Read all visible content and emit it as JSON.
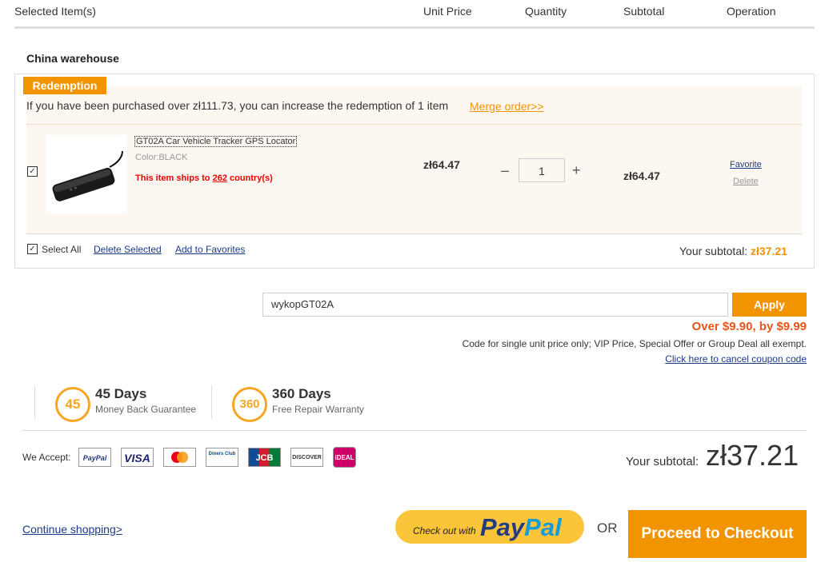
{
  "header": {
    "selected_items": "Selected Item(s)",
    "unit_price": "Unit Price",
    "quantity": "Quantity",
    "subtotal": "Subtotal",
    "operation": "Operation"
  },
  "warehouse": "China warehouse",
  "redemption": {
    "tag": "Redemption",
    "text": "If you have been purchased over zł111.73, you can increase the redemption of 1 item",
    "merge_link": "Merge order>>"
  },
  "item": {
    "checked": true,
    "title": "GT02A Car Vehicle Tracker GPS Locator",
    "color": "Color:BLACK",
    "ships_prefix": "This item ships to ",
    "ships_count": "262",
    "ships_suffix": " country(s)",
    "unit_price": "zł64.47",
    "minus": "–",
    "quantity": "1",
    "plus": "+",
    "subtotal": "zł64.47",
    "favorite": "Favorite",
    "delete": "Delete"
  },
  "footer_bar": {
    "select_all": "Select All",
    "delete_selected": "Delete Selected",
    "add_to_favorites": "Add to Favorites",
    "your_subtotal_label": "Your subtotal: ",
    "your_subtotal_value": "zł37.21"
  },
  "coupon": {
    "value": "wykopGT02A",
    "apply": "Apply",
    "discount": "Over $9.90, by $9.99",
    "note": "Code for single unit price only; VIP Price, Special Offer or Group Deal all exempt.",
    "cancel_link": "Click here to cancel coupon code"
  },
  "guarantees": [
    {
      "badge": "45",
      "title": "45 Days",
      "subtitle": "Money Back Guarantee"
    },
    {
      "badge": "360",
      "title": "360 Days",
      "subtitle": "Free Repair Warranty"
    }
  ],
  "payment": {
    "we_accept": "We Accept:",
    "cards": [
      "PayPal",
      "VISA",
      "Mastercard",
      "Diners Club",
      "JCB",
      "DISCOVER",
      "iDEAL"
    ]
  },
  "summary": {
    "label": "Your subtotal: ",
    "value": "zł37.21"
  },
  "actions": {
    "continue": "Continue shopping>",
    "paypal_small": "Check out with",
    "paypal_big_1": "Pay",
    "paypal_big_2": "Pal",
    "or": "OR",
    "checkout": "Proceed to Checkout"
  },
  "colors": {
    "accent": "#f29400",
    "discount": "#e8541b",
    "paypal_bg": "#fcc439",
    "paypal_dark": "#253b80",
    "paypal_light": "#179bd7"
  }
}
